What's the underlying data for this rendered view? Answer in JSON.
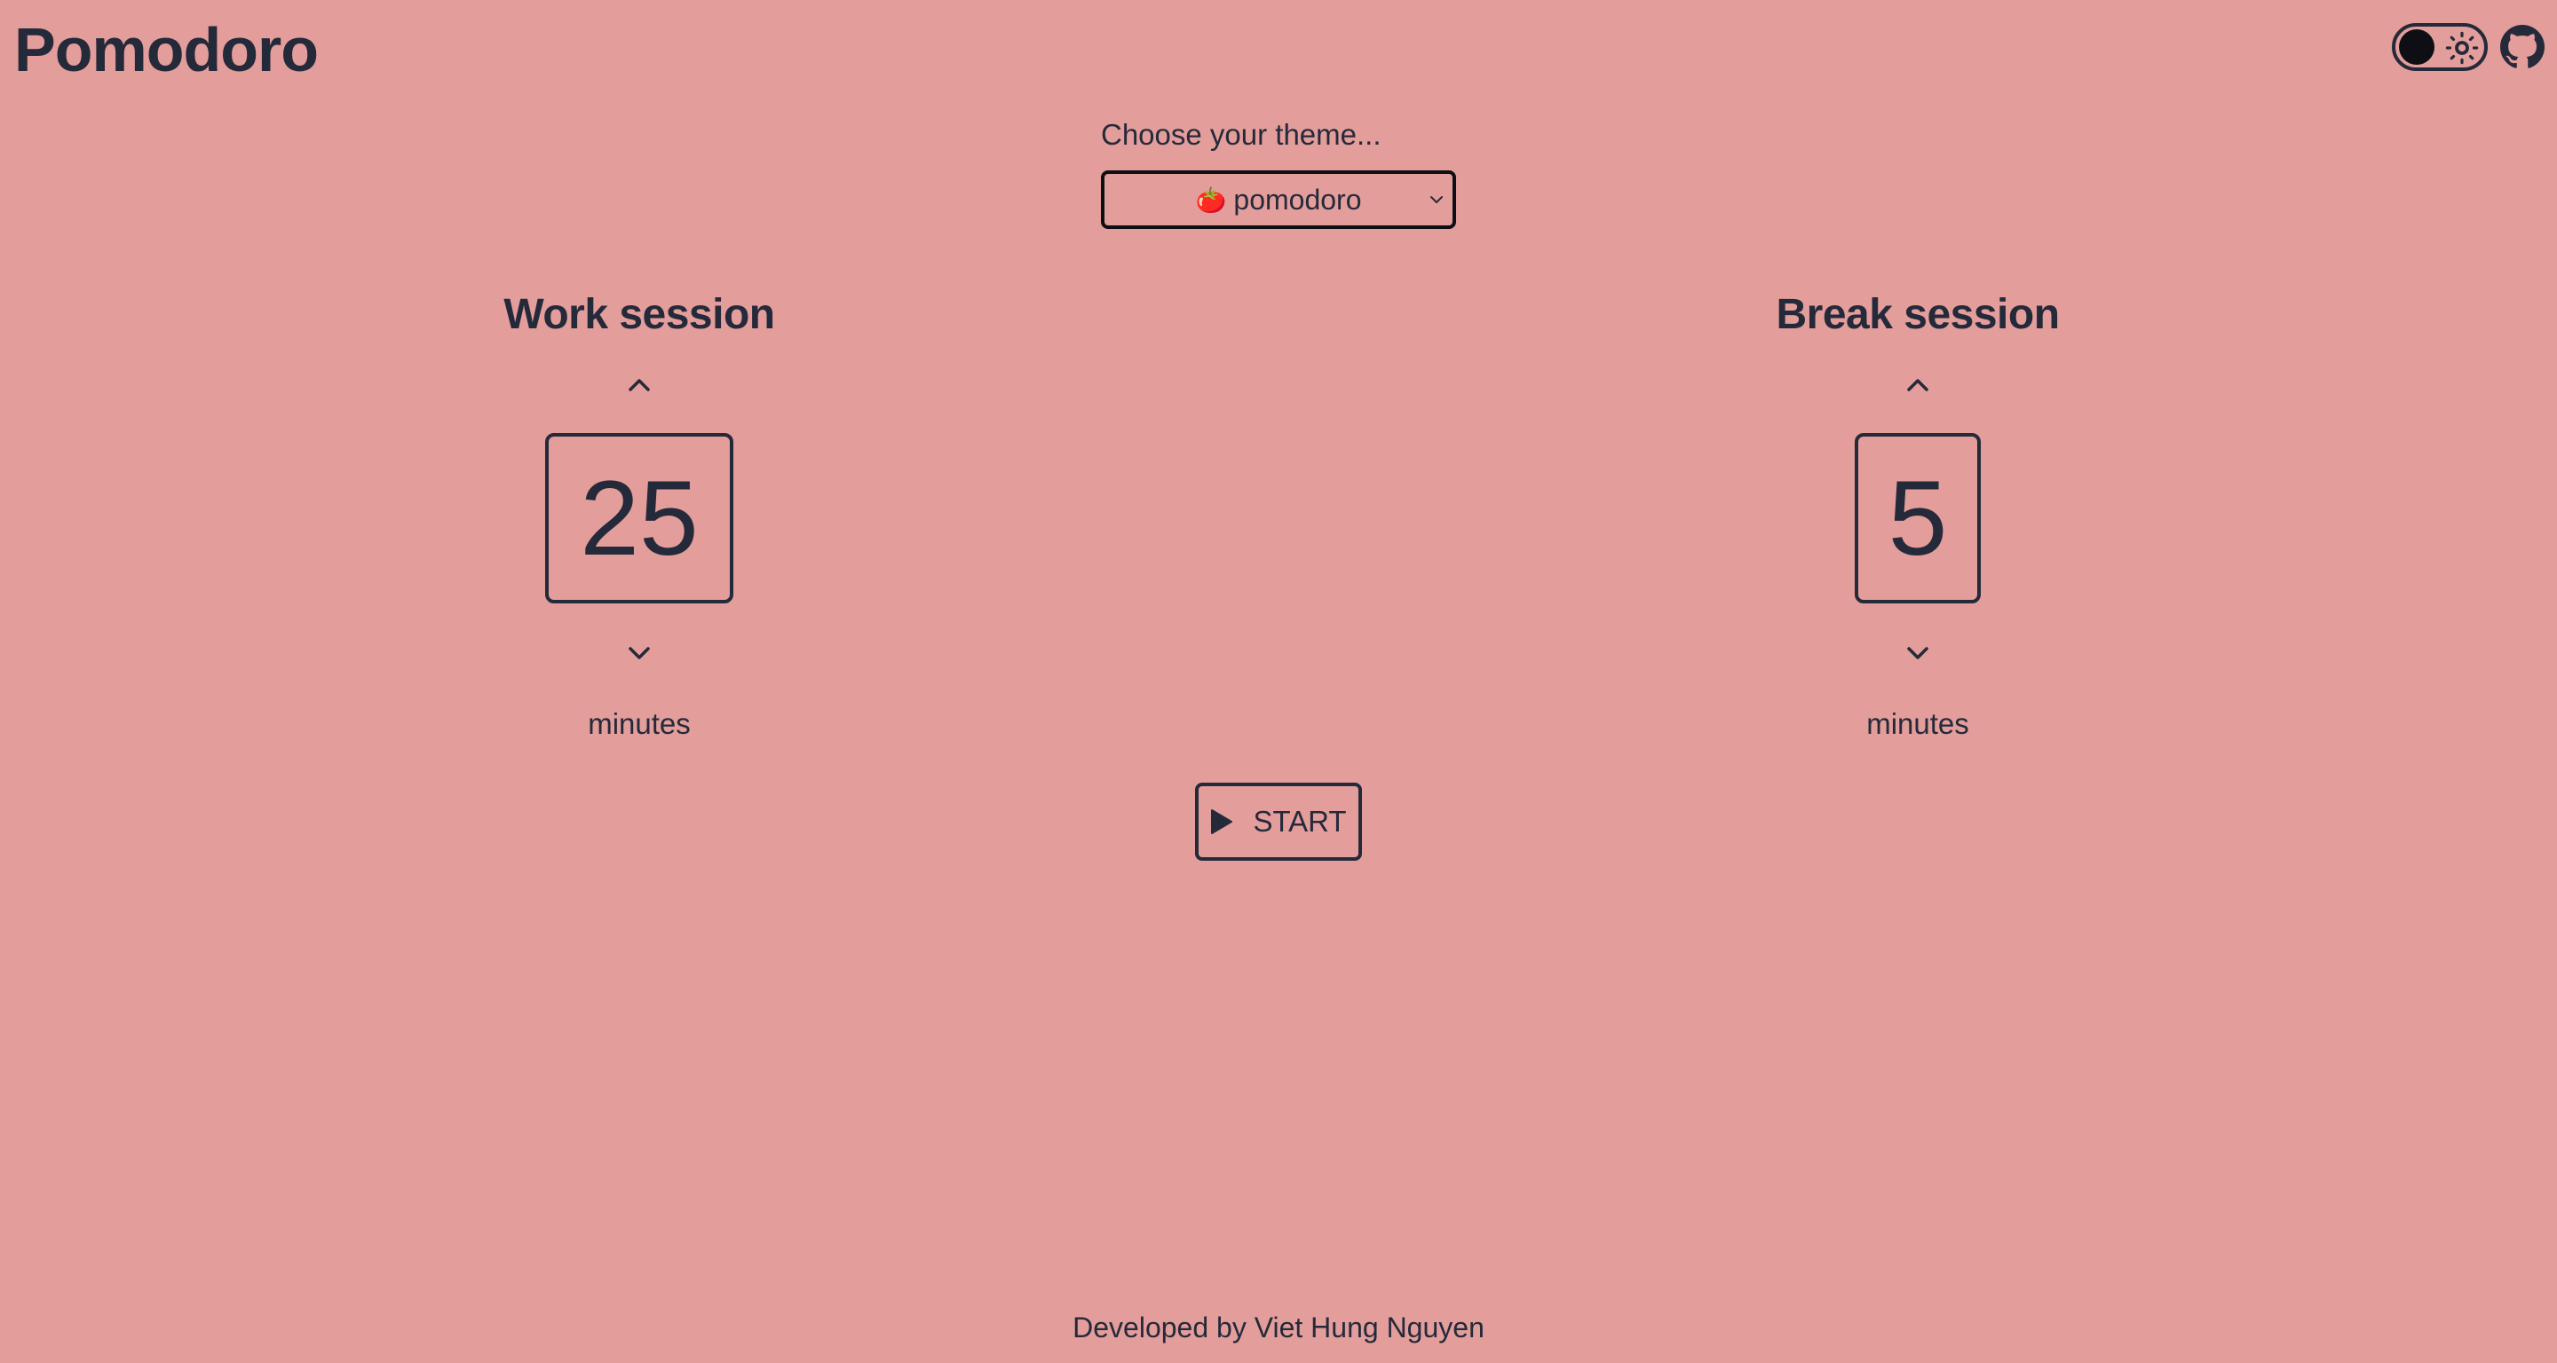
{
  "app": {
    "title": "Pomodoro"
  },
  "header": {
    "theme_toggle_icon": "sun-icon",
    "repo_icon": "github-icon"
  },
  "theme": {
    "label": "Choose your theme...",
    "selected_emoji": "🍅",
    "selected_value": "pomodoro"
  },
  "work": {
    "heading": "Work session",
    "value": "25",
    "unit": "minutes"
  },
  "break": {
    "heading": "Break session",
    "value": "5",
    "unit": "minutes"
  },
  "controls": {
    "start_label": "START"
  },
  "footer": {
    "credit": "Developed by Viet Hung Nguyen"
  },
  "colors": {
    "background": "#e39d9b",
    "foreground": "#252a3a"
  }
}
